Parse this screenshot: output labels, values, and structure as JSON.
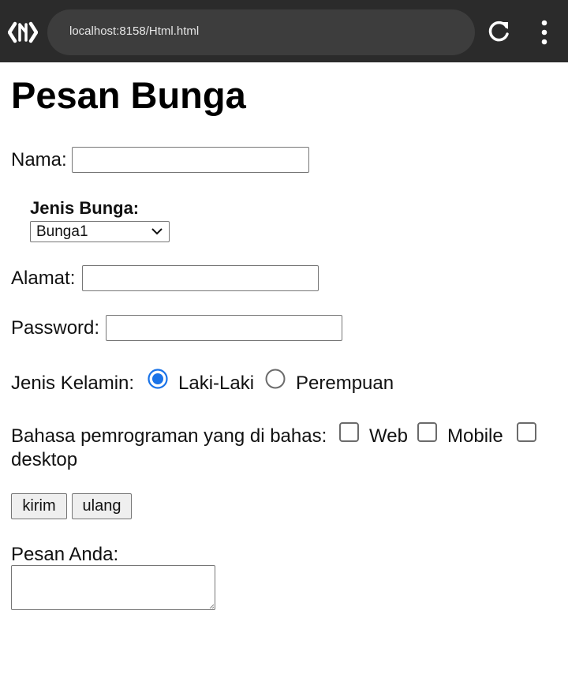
{
  "browser": {
    "url": "localhost:8158/Html.html",
    "logo_icon": "code-brackets-logo-icon",
    "reload_icon": "reload-icon",
    "menu_icon": "kebab-menu-icon"
  },
  "page": {
    "title": "Pesan Bunga",
    "nama_label": "Nama:",
    "nama_value": "",
    "jenis_bunga_label": "Jenis Bunga:",
    "jenis_bunga_selected": "Bunga1",
    "alamat_label": "Alamat:",
    "alamat_value": "",
    "password_label": "Password:",
    "password_value": "",
    "gender_label": "Jenis Kelamin:",
    "gender_options": [
      {
        "label": "Laki-Laki",
        "checked": true
      },
      {
        "label": "Perempuan",
        "checked": false
      }
    ],
    "bahasa_label": "Bahasa pemrograman yang di bahas:",
    "bahasa_options": [
      {
        "label": "Web",
        "checked": false
      },
      {
        "label": "Mobile",
        "checked": false
      },
      {
        "label": "desktop",
        "checked": false
      }
    ],
    "submit_label": "kirim",
    "reset_label": "ulang",
    "pesan_label": "Pesan Anda:",
    "pesan_value": ""
  },
  "colors": {
    "topbar": "#2b2b2b",
    "urlbar": "#3d3d3d",
    "radio_accent": "#1a73e8"
  }
}
